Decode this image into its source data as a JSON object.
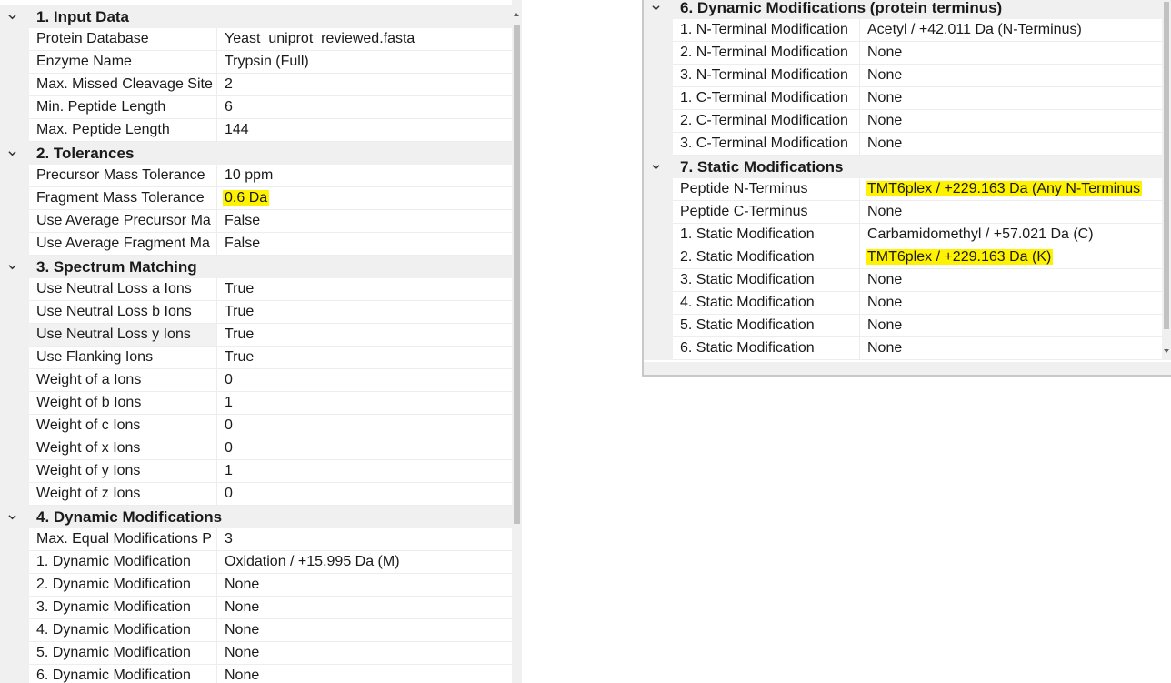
{
  "left_grid": {
    "sections": [
      {
        "title": "1. Input Data",
        "rows": [
          {
            "name": "Protein Database",
            "value": "Yeast_uniprot_reviewed.fasta"
          },
          {
            "name": "Enzyme Name",
            "value": "Trypsin (Full)"
          },
          {
            "name": "Max. Missed Cleavage Site",
            "value": "2"
          },
          {
            "name": "Min. Peptide Length",
            "value": "6"
          },
          {
            "name": "Max. Peptide Length",
            "value": "144"
          }
        ]
      },
      {
        "title": "2. Tolerances",
        "rows": [
          {
            "name": "Precursor Mass Tolerance",
            "value": "10 ppm"
          },
          {
            "name": "Fragment Mass Tolerance",
            "value": "0.6 Da",
            "highlighted": true
          },
          {
            "name": "Use Average Precursor Ma",
            "value": "False"
          },
          {
            "name": "Use Average Fragment Ma",
            "value": "False"
          }
        ]
      },
      {
        "title": "3. Spectrum Matching",
        "rows": [
          {
            "name": "Use Neutral Loss a Ions",
            "value": "True"
          },
          {
            "name": "Use Neutral Loss b Ions",
            "value": "True"
          },
          {
            "name": "Use Neutral Loss y Ions",
            "value": "True",
            "selected": true
          },
          {
            "name": "Use Flanking Ions",
            "value": "True"
          },
          {
            "name": "Weight of a Ions",
            "value": "0"
          },
          {
            "name": "Weight of b Ions",
            "value": "1"
          },
          {
            "name": "Weight of c Ions",
            "value": "0"
          },
          {
            "name": "Weight of x Ions",
            "value": "0"
          },
          {
            "name": "Weight of y Ions",
            "value": "1"
          },
          {
            "name": "Weight of z Ions",
            "value": "0"
          }
        ]
      },
      {
        "title": "4. Dynamic Modifications",
        "rows": [
          {
            "name": "Max. Equal Modifications P",
            "value": "3"
          },
          {
            "name": "1. Dynamic Modification",
            "value": "Oxidation / +15.995 Da (M)"
          },
          {
            "name": "2. Dynamic Modification",
            "value": "None"
          },
          {
            "name": "3. Dynamic Modification",
            "value": "None"
          },
          {
            "name": "4. Dynamic Modification",
            "value": "None"
          },
          {
            "name": "5. Dynamic Modification",
            "value": "None"
          },
          {
            "name": "6. Dynamic Modification",
            "value": "None"
          }
        ]
      }
    ]
  },
  "right_grid": {
    "sections": [
      {
        "title": "6. Dynamic Modifications (protein terminus)",
        "rows": [
          {
            "name": "1. N-Terminal Modification",
            "value": "Acetyl / +42.011 Da (N-Terminus)"
          },
          {
            "name": "2. N-Terminal Modification",
            "value": "None"
          },
          {
            "name": "3. N-Terminal Modification",
            "value": "None"
          },
          {
            "name": "1. C-Terminal Modification",
            "value": "None"
          },
          {
            "name": "2. C-Terminal Modification",
            "value": "None"
          },
          {
            "name": "3. C-Terminal Modification",
            "value": "None"
          }
        ]
      },
      {
        "title": "7. Static Modifications",
        "rows": [
          {
            "name": "Peptide N-Terminus",
            "value": "TMT6plex / +229.163 Da (Any N-Terminus",
            "highlighted": true
          },
          {
            "name": "Peptide C-Terminus",
            "value": "None"
          },
          {
            "name": "1. Static Modification",
            "value": "Carbamidomethyl / +57.021 Da (C)"
          },
          {
            "name": "2. Static Modification",
            "value": "TMT6plex / +229.163 Da (K)",
            "highlighted": true
          },
          {
            "name": "3. Static Modification",
            "value": "None"
          },
          {
            "name": "4. Static Modification",
            "value": "None"
          },
          {
            "name": "5. Static Modification",
            "value": "None"
          },
          {
            "name": "6. Static Modification",
            "value": "None"
          }
        ]
      }
    ]
  },
  "colors": {
    "highlight": "#fff200",
    "category_bg": "#f0f0f0",
    "grid_line": "#ededed",
    "scroll_thumb": "#c1c1c1"
  },
  "icons": {
    "expander": "chevron-down-icon",
    "scroll_up": "scroll-up-arrow-icon",
    "scroll_down": "scroll-down-arrow-icon"
  }
}
